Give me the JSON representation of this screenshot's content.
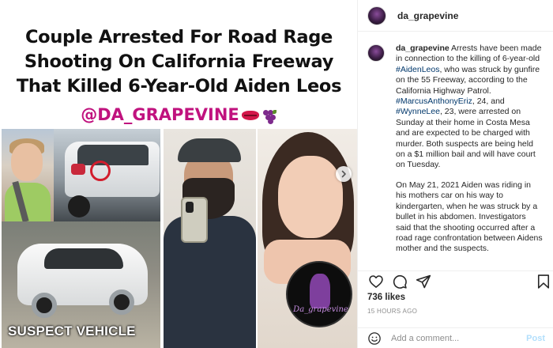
{
  "post_image": {
    "headline_lines": [
      "Couple Arrested For Road Rage",
      "Shooting On California Freeway",
      "That Killed 6-Year-Old Aiden Leos"
    ],
    "handle": "@DA_GRAPEVINE",
    "suspect_label": "SUSPECT VEHICLE",
    "watermark_text": "Da_grapevine",
    "colors": {
      "handle": "#c0127e",
      "headline": "#111111"
    }
  },
  "header": {
    "username": "da_grapevine"
  },
  "caption": {
    "username": "da_grapevine",
    "p1_a": " Arrests have been made in connection to the killing of 6-year-old ",
    "tag_aiden": "#AidenLeos",
    "p1_b": ", who was struck by gunfire on the 55 Freeway, according to the California Highway Patrol. ",
    "tag_marcus": "#MarcusAnthonyEriz",
    "p1_c": ", 24, and ",
    "tag_wynne": "#WynneLee",
    "p1_d": ", 23, were arrested on Sunday at their home in Costa Mesa and are expected to be charged with murder. Both suspects are being held on a $1 million bail and will have court on Tuesday.",
    "p2": "On May 21, 2021 Aiden was riding in his mothers car on his way to kindergarten, when he was struck by a bullet in his abdomen. Investigators said that the shooting occurred after a road rage confrontation between Aidens mother and the suspects."
  },
  "actions": {
    "icons": [
      "heart-icon",
      "comment-icon",
      "share-icon",
      "bookmark-icon"
    ],
    "likes": "736 likes",
    "posted_ago": "15 HOURS AGO"
  },
  "comment": {
    "placeholder": "Add a comment...",
    "post_label": "Post"
  }
}
